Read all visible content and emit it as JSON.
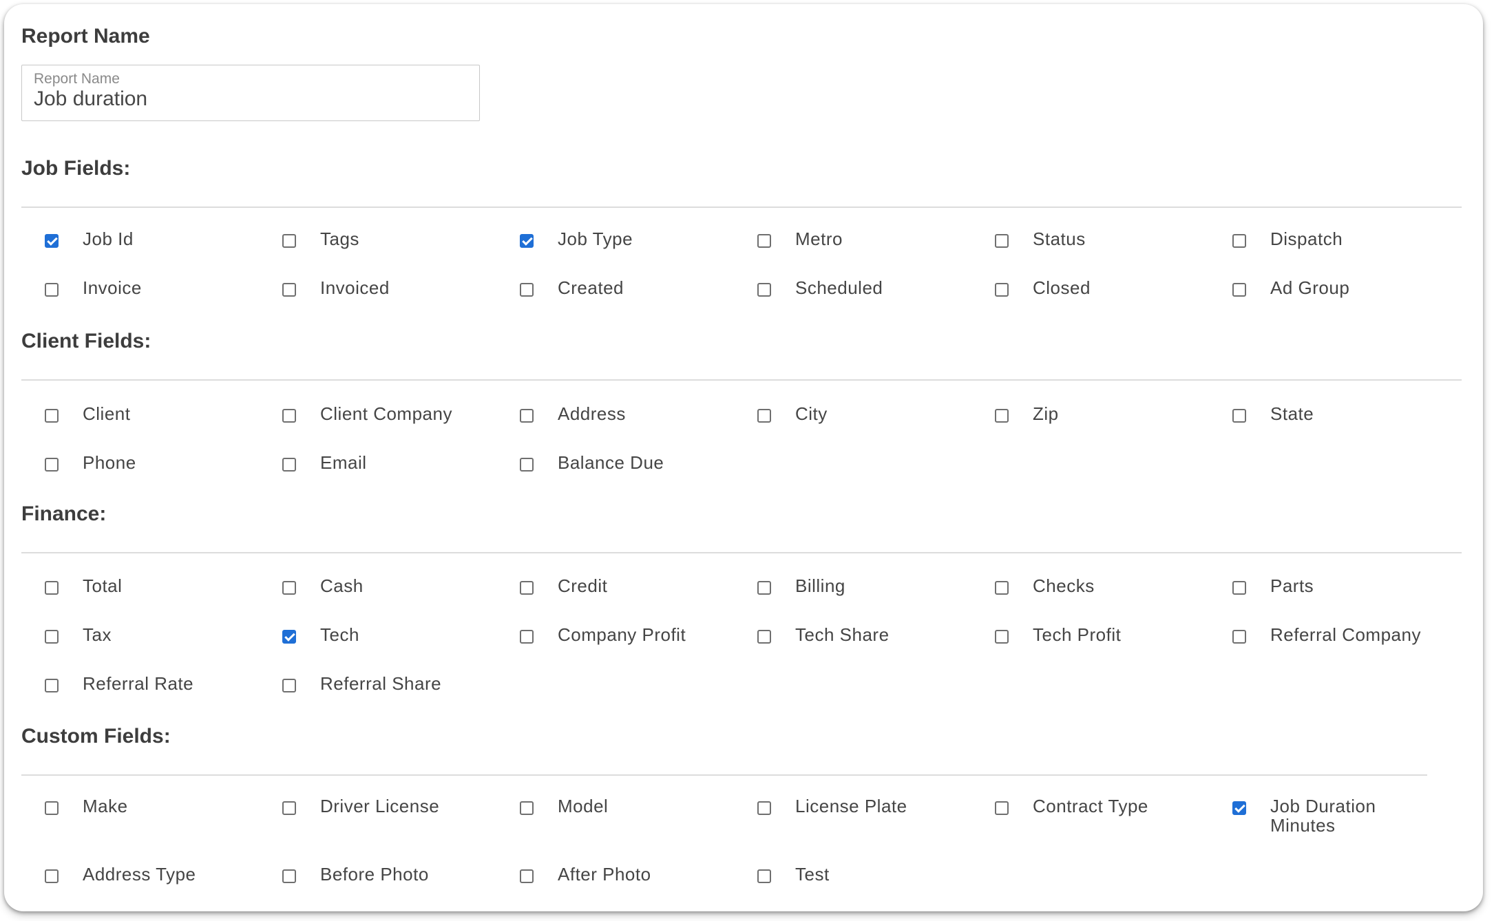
{
  "report_name": {
    "title": "Report Name",
    "field_label": "Report Name",
    "value": "Job duration"
  },
  "sections": [
    {
      "title": "Job Fields:",
      "fields": [
        {
          "label": "Job Id",
          "checked": true
        },
        {
          "label": "Tags",
          "checked": false
        },
        {
          "label": "Job Type",
          "checked": true
        },
        {
          "label": "Metro",
          "checked": false
        },
        {
          "label": "Status",
          "checked": false
        },
        {
          "label": "Dispatch",
          "checked": false
        },
        {
          "label": "Invoice",
          "checked": false
        },
        {
          "label": "Invoiced",
          "checked": false
        },
        {
          "label": "Created",
          "checked": false
        },
        {
          "label": "Scheduled",
          "checked": false
        },
        {
          "label": "Closed",
          "checked": false
        },
        {
          "label": "Ad Group",
          "checked": false
        }
      ]
    },
    {
      "title": "Client Fields:",
      "fields": [
        {
          "label": "Client",
          "checked": false
        },
        {
          "label": "Client Company",
          "checked": false
        },
        {
          "label": "Address",
          "checked": false
        },
        {
          "label": "City",
          "checked": false
        },
        {
          "label": "Zip",
          "checked": false
        },
        {
          "label": "State",
          "checked": false
        },
        {
          "label": "Phone",
          "checked": false
        },
        {
          "label": "Email",
          "checked": false
        },
        {
          "label": "Balance Due",
          "checked": false
        }
      ]
    },
    {
      "title": "Finance:",
      "fields": [
        {
          "label": "Total",
          "checked": false
        },
        {
          "label": "Cash",
          "checked": false
        },
        {
          "label": "Credit",
          "checked": false
        },
        {
          "label": "Billing",
          "checked": false
        },
        {
          "label": "Checks",
          "checked": false
        },
        {
          "label": "Parts",
          "checked": false
        },
        {
          "label": "Tax",
          "checked": false
        },
        {
          "label": "Tech",
          "checked": true
        },
        {
          "label": "Company Profit",
          "checked": false
        },
        {
          "label": "Tech Share",
          "checked": false
        },
        {
          "label": "Tech Profit",
          "checked": false
        },
        {
          "label": "Referral Company",
          "checked": false
        },
        {
          "label": "Referral Rate",
          "checked": false
        },
        {
          "label": "Referral Share",
          "checked": false
        }
      ]
    },
    {
      "title": "Custom Fields:",
      "fields": [
        {
          "label": "Make",
          "checked": false
        },
        {
          "label": "Driver License",
          "checked": false
        },
        {
          "label": "Model",
          "checked": false
        },
        {
          "label": "License Plate",
          "checked": false
        },
        {
          "label": "Contract Type",
          "checked": false
        },
        {
          "label": "Job Duration Minutes",
          "checked": true
        },
        {
          "label": "Address Type",
          "checked": false
        },
        {
          "label": "Before Photo",
          "checked": false
        },
        {
          "label": "After Photo",
          "checked": false
        },
        {
          "label": "Test",
          "checked": false
        }
      ]
    }
  ],
  "colors": {
    "checkbox_checked": "#1f6fd6",
    "checkbox_border": "#6f6f6f",
    "text": "#454545"
  }
}
